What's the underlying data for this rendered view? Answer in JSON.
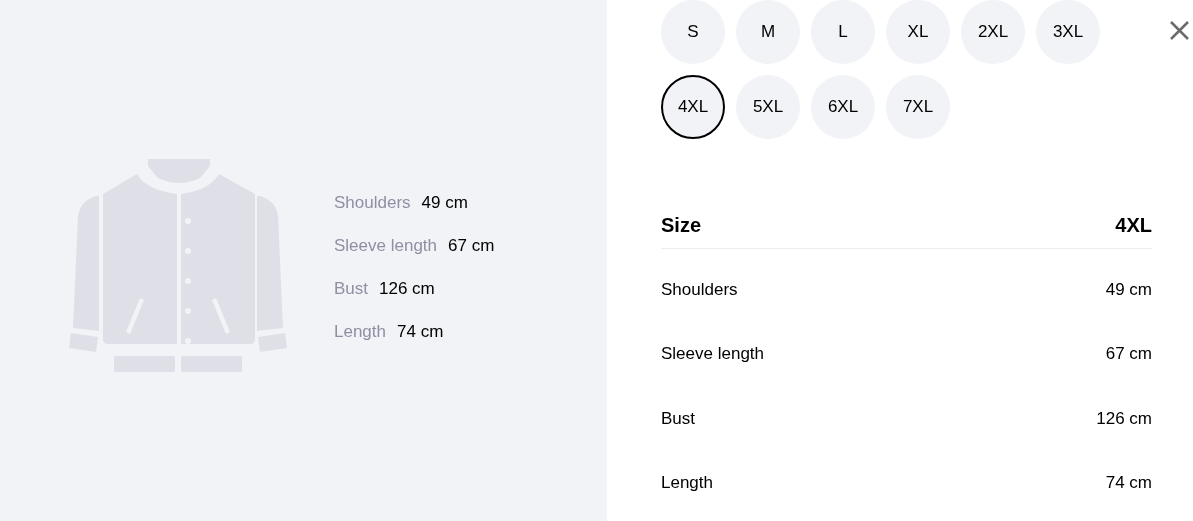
{
  "sizes": [
    {
      "label": "S",
      "selected": false
    },
    {
      "label": "M",
      "selected": false
    },
    {
      "label": "L",
      "selected": false
    },
    {
      "label": "XL",
      "selected": false
    },
    {
      "label": "2XL",
      "selected": false
    },
    {
      "label": "3XL",
      "selected": false
    },
    {
      "label": "4XL",
      "selected": true
    },
    {
      "label": "5XL",
      "selected": false
    },
    {
      "label": "6XL",
      "selected": false
    },
    {
      "label": "7XL",
      "selected": false
    }
  ],
  "preview_measurements": [
    {
      "label": "Shoulders",
      "value": "49 cm"
    },
    {
      "label": "Sleeve length",
      "value": "67 cm"
    },
    {
      "label": "Bust",
      "value": "126 cm"
    },
    {
      "label": "Length",
      "value": "74 cm"
    }
  ],
  "table": {
    "header": {
      "label": "Size",
      "value": "4XL"
    },
    "rows": [
      {
        "label": "Shoulders",
        "value": "49 cm"
      },
      {
        "label": "Sleeve length",
        "value": "67 cm"
      },
      {
        "label": "Bust",
        "value": "126 cm"
      },
      {
        "label": "Length",
        "value": "74 cm"
      }
    ]
  }
}
